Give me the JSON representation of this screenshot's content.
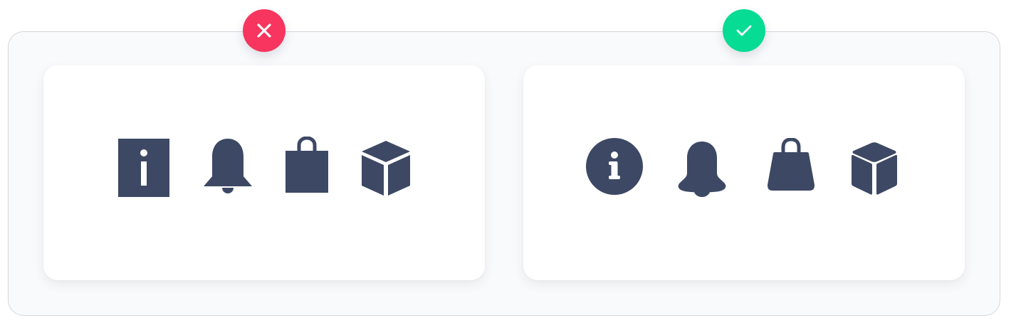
{
  "colors": {
    "icon_fill": "#3d4864",
    "bad_badge": "#f7355e",
    "good_badge": "#06dc93",
    "frame_border": "#d4d6dc",
    "frame_background": "#f9fafc",
    "card_background": "#ffffff"
  },
  "examples": [
    {
      "verdict": "incorrect",
      "badge_icon": "x-icon",
      "icon_style": "sharp-cornered",
      "icons": [
        "info-icon",
        "bell-icon",
        "shopping-bag-icon",
        "box-icon"
      ]
    },
    {
      "verdict": "correct",
      "badge_icon": "check-icon",
      "icon_style": "rounded",
      "icons": [
        "info-icon",
        "bell-icon",
        "shopping-bag-icon",
        "box-icon"
      ]
    }
  ]
}
